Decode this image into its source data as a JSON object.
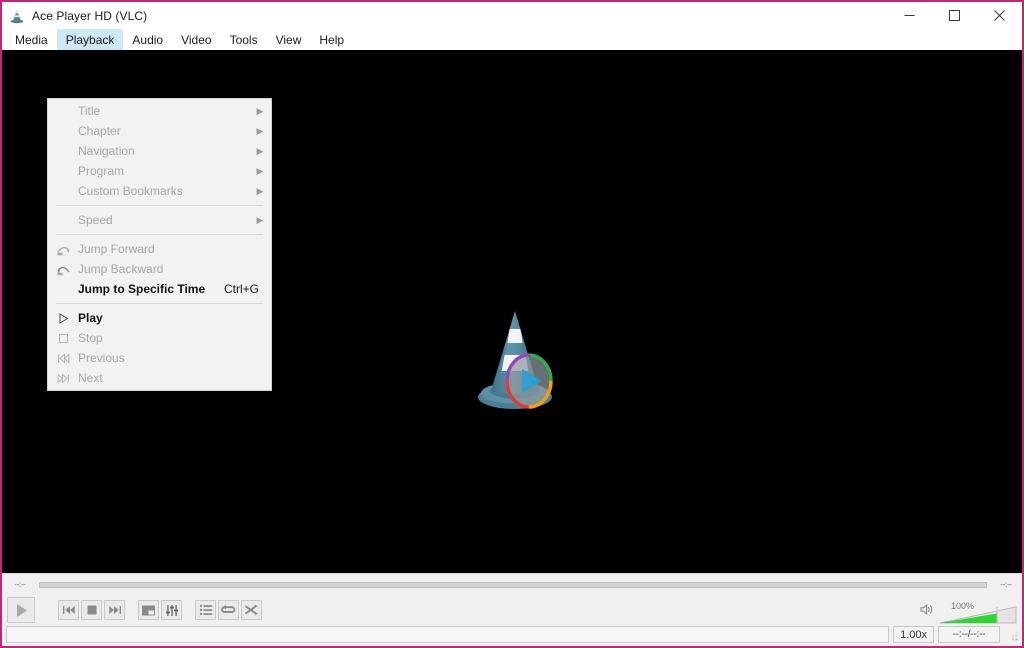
{
  "window": {
    "title": "Ace Player HD (VLC)",
    "border_color": "#c2267a",
    "accent_highlight": "#cde8f7",
    "controls": {
      "minimize": "−",
      "maximize": "□",
      "close": "✕"
    }
  },
  "menubar": {
    "items": [
      {
        "label": "Media",
        "active": false
      },
      {
        "label": "Playback",
        "active": true
      },
      {
        "label": "Audio",
        "active": false
      },
      {
        "label": "Video",
        "active": false
      },
      {
        "label": "Tools",
        "active": false
      },
      {
        "label": "View",
        "active": false
      },
      {
        "label": "Help",
        "active": false
      }
    ]
  },
  "playback_menu": {
    "items": [
      {
        "label": "Title",
        "icon": "none",
        "accel": "",
        "submenu": true,
        "enabled": false
      },
      {
        "label": "Chapter",
        "icon": "none",
        "accel": "",
        "submenu": true,
        "enabled": false
      },
      {
        "label": "Navigation",
        "icon": "none",
        "accel": "",
        "submenu": true,
        "enabled": false
      },
      {
        "label": "Program",
        "icon": "none",
        "accel": "",
        "submenu": true,
        "enabled": false
      },
      {
        "label": "Custom Bookmarks",
        "icon": "none",
        "accel": "",
        "submenu": true,
        "enabled": false
      },
      {
        "separator": true
      },
      {
        "label": "Speed",
        "icon": "none",
        "accel": "",
        "submenu": true,
        "enabled": false
      },
      {
        "separator": true
      },
      {
        "label": "Jump Forward",
        "icon": "jump-forward-icon",
        "accel": "",
        "submenu": false,
        "enabled": false
      },
      {
        "label": "Jump Backward",
        "icon": "jump-backward-icon",
        "accel": "",
        "submenu": false,
        "enabled": false
      },
      {
        "label": "Jump to Specific Time",
        "icon": "none",
        "accel": "Ctrl+G",
        "submenu": false,
        "enabled": true
      },
      {
        "separator": true
      },
      {
        "label": "Play",
        "icon": "play-icon",
        "accel": "",
        "submenu": false,
        "enabled": true
      },
      {
        "label": "Stop",
        "icon": "stop-icon",
        "accel": "",
        "submenu": false,
        "enabled": false
      },
      {
        "label": "Previous",
        "icon": "previous-icon",
        "accel": "",
        "submenu": false,
        "enabled": false
      },
      {
        "label": "Next",
        "icon": "next-icon",
        "accel": "",
        "submenu": false,
        "enabled": false
      }
    ]
  },
  "video": {
    "logo": "vlc-cone-logo",
    "background_color": "#000000"
  },
  "seekbar": {
    "elapsed_label": "--:--",
    "remaining_label": "--:--",
    "progress_percent": 0
  },
  "controls": {
    "buttons": [
      {
        "name": "play-button",
        "icon": "play-icon"
      },
      {
        "name": "previous-button",
        "icon": "previous-icon"
      },
      {
        "name": "stop-button",
        "icon": "stop-icon"
      },
      {
        "name": "next-button",
        "icon": "next-icon"
      },
      {
        "name": "fullscreen-button",
        "icon": "fullscreen-icon"
      },
      {
        "name": "equalizer-button",
        "icon": "equalizer-icon"
      },
      {
        "name": "playlist-button",
        "icon": "playlist-icon"
      },
      {
        "name": "loop-button",
        "icon": "loop-icon"
      },
      {
        "name": "shuffle-button",
        "icon": "shuffle-icon"
      }
    ],
    "volume": {
      "icon": "speaker-icon",
      "percent_label": "100%",
      "value": 100,
      "fill_color": "#2fd62f"
    }
  },
  "status": {
    "input_value": "",
    "speed_label": "1.00x",
    "time_label": "--:--/--:--"
  }
}
